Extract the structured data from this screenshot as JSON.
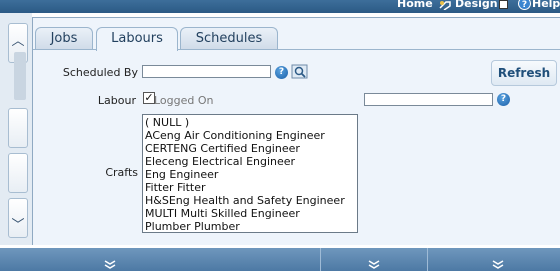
{
  "topbar": {
    "home": "Home",
    "design": "Design",
    "help": "Help"
  },
  "tabs": [
    {
      "label": "Jobs"
    },
    {
      "label": "Labours"
    },
    {
      "label": "Schedules"
    }
  ],
  "form": {
    "scheduled_by_label": "Scheduled By",
    "scheduled_by_value": "",
    "labour_label": "Labour",
    "logged_on_label": "Logged On",
    "logged_on_checked": true,
    "labour_value": "",
    "crafts_label": "Crafts",
    "refresh_label": "Refresh",
    "help_glyph": "?"
  },
  "crafts": [
    "( NULL )",
    "ACeng Air Conditioning Engineer",
    "CERTENG Certified Engineer",
    "Eleceng Electrical Engineer",
    "Eng Engineer",
    "Fitter Fitter",
    "H&SEng Health and Safety Engineer",
    "MULTI Multi Skilled Engineer",
    "Plumber Plumber"
  ],
  "colors": {
    "topbar": "#2b5a85",
    "bottombar": "#4d79a4",
    "panel": "#eef4fb"
  }
}
